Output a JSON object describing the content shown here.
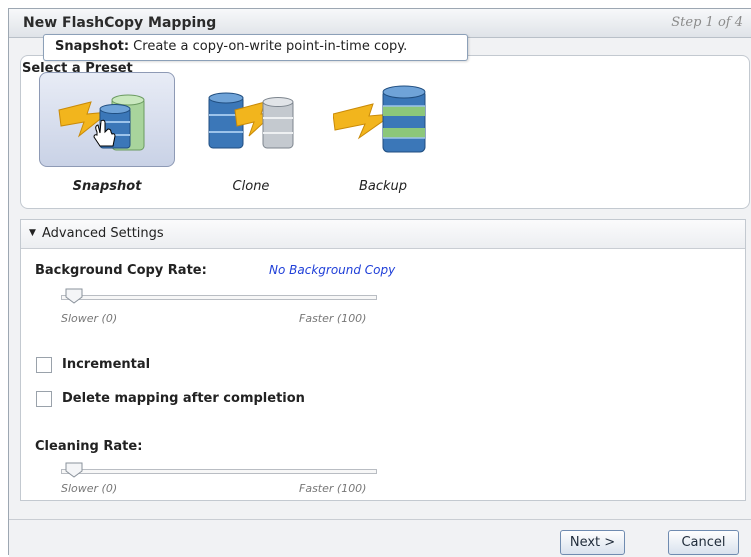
{
  "dialog": {
    "title": "New FlashCopy Mapping",
    "step": "Step 1 of 4"
  },
  "tooltip": {
    "label": "Snapshot:",
    "text": " Create a copy-on-write point-in-time copy."
  },
  "presets": {
    "title": "Select a Preset",
    "items": [
      {
        "label": "Snapshot",
        "selected": true,
        "icon": "snapshot-icon"
      },
      {
        "label": "Clone",
        "selected": false,
        "icon": "clone-icon"
      },
      {
        "label": "Backup",
        "selected": false,
        "icon": "backup-icon"
      }
    ]
  },
  "advanced": {
    "header": "Advanced Settings",
    "background_copy_rate": {
      "label": "Background Copy Rate:",
      "value": "No Background Copy",
      "slider_value": 0,
      "min_label": "Slower (0)",
      "max_label": "Faster (100)"
    },
    "incremental": {
      "label": "Incremental",
      "checked": false
    },
    "delete_mapping": {
      "label": "Delete mapping after completion",
      "checked": false
    },
    "cleaning_rate": {
      "label": "Cleaning Rate:",
      "slider_value": 0,
      "min_label": "Slower (0)",
      "max_label": "Faster (100)"
    }
  },
  "buttons": {
    "next": "Next >",
    "cancel": "Cancel"
  },
  "colors": {
    "accent_link": "#1f3fd8",
    "selected_tile": "#c9d2e6"
  }
}
